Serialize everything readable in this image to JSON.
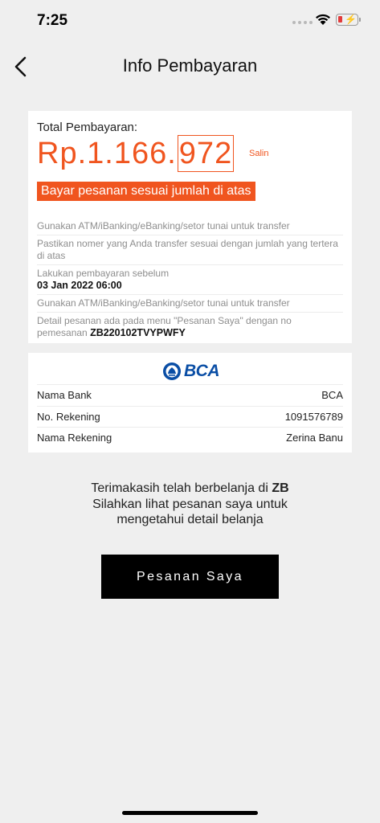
{
  "status_bar": {
    "time": "7:25"
  },
  "nav": {
    "title": "Info Pembayaran"
  },
  "payment": {
    "total_label": "Total Pembayaran:",
    "amount_prefix": "Rp.1.166.",
    "amount_highlight": "972",
    "copy_label": "Salin",
    "warning": "Bayar pesanan sesuai jumlah di atas",
    "instructions": [
      "Gunakan ATM/iBanking/eBanking/setor tunai untuk transfer",
      "Pastikan nomer yang Anda transfer sesuai dengan jumlah yang tertera di atas",
      "Lakukan pembayaran sebelum",
      "Gunakan ATM/iBanking/eBanking/setor tunai untuk transfer",
      "Detail pesanan ada pada menu \"Pesanan Saya\" dengan no pemesanan"
    ],
    "deadline": "03 Jan 2022 06:00",
    "order_number": "ZB220102TVYPWFY"
  },
  "bank": {
    "logo_text": "BCA",
    "rows": [
      {
        "label": "Nama Bank",
        "value": "BCA"
      },
      {
        "label": "No. Rekening",
        "value": "1091576789"
      },
      {
        "label": "Nama Rekening",
        "value": "Zerina Banu"
      }
    ]
  },
  "thanks": {
    "line1_prefix": "Terimakasih telah berbelanja di",
    "line1_brand": "ZB",
    "line2": "Silahkan lihat pesanan saya untuk",
    "line3": "mengetahui detail belanja"
  },
  "button": {
    "label": "Pesanan Saya"
  },
  "colors": {
    "accent": "#f0551f",
    "bank_blue": "#0a4ea5",
    "background": "#efefef"
  }
}
